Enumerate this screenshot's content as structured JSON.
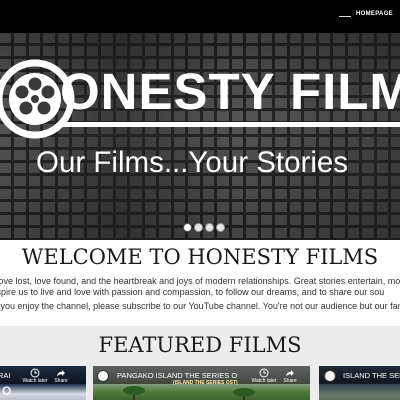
{
  "nav": {
    "homepage_label": "HOMEPAGE"
  },
  "hero": {
    "logo_wordmark": "ONESTY FILM",
    "tagline": "Our Films...Your Stories",
    "slides": [
      {
        "active": true
      },
      {
        "active": false
      },
      {
        "active": false
      },
      {
        "active": false
      }
    ]
  },
  "welcome": {
    "title": "WELCOME TO HONESTY FILMS",
    "intro_lines": [
      "tories of love lost, love found, and the heartbreak and joys of modern relationships. Great stories entertain, mo",
      "ded to inspire us to live and love with passion and compassion, to follow our dreams, and to share our sou",
      "If you enjoy the channel, please subscribe to our YouTube channel.  You're not our audience but our family"
    ]
  },
  "featured": {
    "title": "FEATURED FILMS",
    "videos": [
      {
        "title": "RAI",
        "watermark": "O",
        "watch_later_label": "Watch later",
        "share_label": "Share"
      },
      {
        "title": "PANGAKO ISLAND THE SERIES OFF",
        "subtitle": "(ISLAND THE SERIES OST)",
        "watch_later_label": "Watch later",
        "share_label": "Share"
      },
      {
        "title": "ISLAND THE SERIE"
      }
    ]
  },
  "colors": {
    "nav_background": "#000000",
    "hero_text": "#ffffff",
    "heading_text": "#1a1a1a",
    "body_text": "#333333",
    "featured_band": "#ececec"
  }
}
